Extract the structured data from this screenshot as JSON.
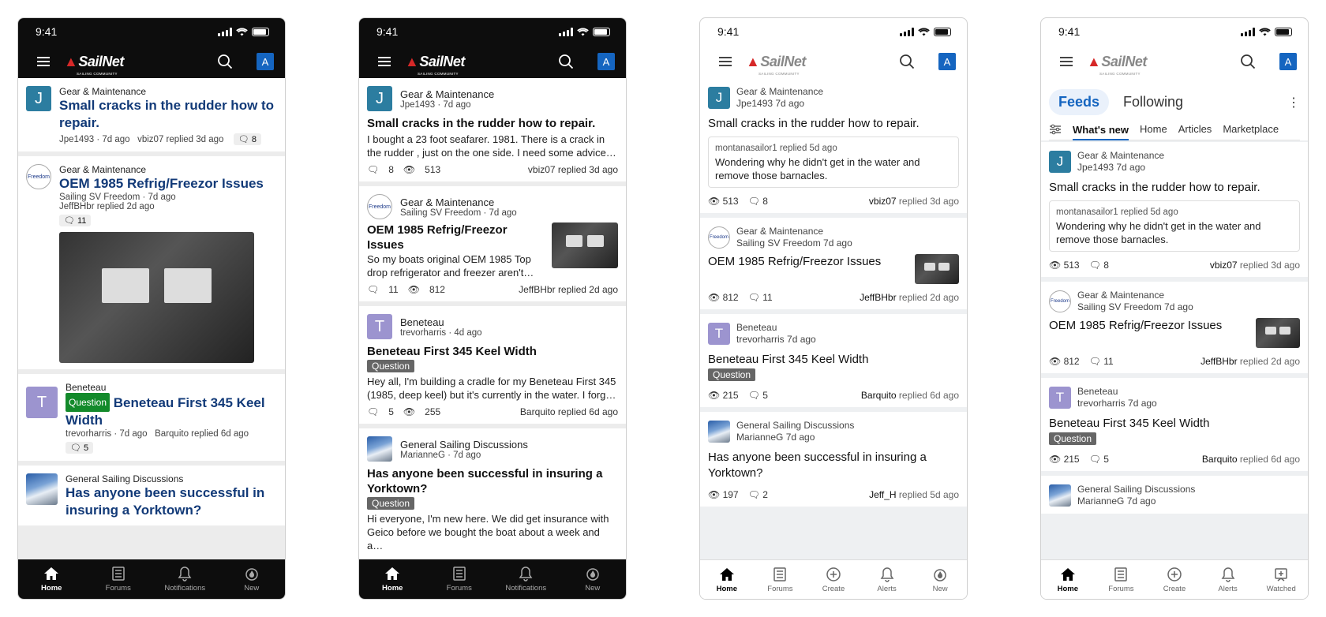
{
  "status_time": "9:41",
  "logo": {
    "brand": "SailNet",
    "sub": "SAILING COMMUNITY"
  },
  "avatar_letter": "A",
  "colors": {
    "accent": "#1565c0",
    "title_blue": "#123a78",
    "question_green": "#138a2b"
  },
  "tabs_v1": [
    {
      "label": "Home",
      "icon": "home-icon"
    },
    {
      "label": "Forums",
      "icon": "forums-icon"
    },
    {
      "label": "Notifications",
      "icon": "bell-icon"
    },
    {
      "label": "New",
      "icon": "flame-icon"
    }
  ],
  "tabs_v3": [
    {
      "label": "Home",
      "icon": "home-icon"
    },
    {
      "label": "Forums",
      "icon": "forums-icon"
    },
    {
      "label": "Create",
      "icon": "plus-icon"
    },
    {
      "label": "Alerts",
      "icon": "bell-icon"
    },
    {
      "label": "New",
      "icon": "flame-icon"
    }
  ],
  "tabs_v4": [
    {
      "label": "Home",
      "icon": "home-icon"
    },
    {
      "label": "Forums",
      "icon": "forums-icon"
    },
    {
      "label": "Create",
      "icon": "plus-icon"
    },
    {
      "label": "Alerts",
      "icon": "bell-icon"
    },
    {
      "label": "Watched",
      "icon": "watched-icon"
    }
  ],
  "p1": {
    "posts": [
      {
        "forum": "Gear & Maintenance",
        "title": "Small cracks in the rudder how to repair.",
        "meta": "Jpe1493 · 7d ago   vbiz07 replied 3d ago",
        "count": "8"
      },
      {
        "forum": "Gear & Maintenance",
        "title": "OEM 1985 Refrig/Freezor Issues",
        "meta": "Sailing SV Freedom · 7d ago",
        "meta2": "JeffBHbr replied 2d ago",
        "count": "11"
      },
      {
        "forum": "Beneteau",
        "badge": "Question",
        "title": "Beneteau First 345 Keel Width",
        "meta": "trevorharris · 7d ago   Barquito replied 6d ago",
        "count": "5"
      },
      {
        "forum": "General Sailing Discussions",
        "title": "Has anyone been successful in insuring a Yorktown?"
      }
    ]
  },
  "p2": {
    "posts": [
      {
        "forum": "Gear & Maintenance",
        "author": "Jpe1493",
        "age": "7d ago",
        "title": "Small cracks in the rudder how to repair.",
        "snippet": "I bought a 23 foot seafarer. 1981. There is a crack in the rudder , just on the one side. I need some advice…",
        "comments": "8",
        "views": "513",
        "reply": "vbiz07 replied 3d ago"
      },
      {
        "forum": "Gear & Maintenance",
        "author": "Sailing SV Freedom",
        "age": "7d ago",
        "title": "OEM 1985 Refrig/Freezor Issues",
        "snippet": "So my boats original OEM 1985 Top drop refrigerator and freezer aren't…",
        "comments": "11",
        "views": "812",
        "reply": "JeffBHbr replied 2d ago"
      },
      {
        "forum": "Beneteau",
        "author": "trevorharris",
        "age": "4d ago",
        "title": "Beneteau First 345 Keel Width",
        "badge": "Question",
        "snippet": "Hey all, I'm building a cradle for my Beneteau First 345 (1985, deep keel) but it's currently in the water. I forg…",
        "comments": "5",
        "views": "255",
        "reply": "Barquito replied 6d ago"
      },
      {
        "forum": "General Sailing Discussions",
        "author": "MarianneG",
        "age": "7d ago",
        "title": "Has anyone been successful in insuring a Yorktown?",
        "badge": "Question",
        "snippet": "Hi everyone, I'm new here. We did get insurance with Geico before we bought the boat about a week and a…"
      }
    ]
  },
  "p3": {
    "posts": [
      {
        "forum": "Gear & Maintenance",
        "authorline": "Jpe1493 7d ago",
        "title": "Small cracks in the rudder how to repair.",
        "quote_meta": "montanasailor1 replied 5d ago",
        "quote": "Wondering why he didn't get in the water and remove those barnacles.",
        "views": "513",
        "comments": "8",
        "reply_user": "vbiz07",
        "reply_rest": " replied 3d ago"
      },
      {
        "forum": "Gear & Maintenance",
        "authorline": "Sailing SV Freedom 7d ago",
        "title": "OEM 1985 Refrig/Freezor Issues",
        "views": "812",
        "comments": "11",
        "reply_user": "JeffBHbr",
        "reply_rest": " replied 2d ago"
      },
      {
        "forum": "Beneteau",
        "authorline": "trevorharris 7d ago",
        "title": "Beneteau First 345 Keel Width",
        "badge": "Question",
        "views": "215",
        "comments": "5",
        "reply_user": "Barquito",
        "reply_rest": " replied 6d ago"
      },
      {
        "forum": "General Sailing Discussions",
        "authorline": "MarianneG 7d ago",
        "title": "Has anyone been successful in insuring a Yorktown?",
        "views": "197",
        "comments": "2",
        "reply_user": "Jeff_H",
        "reply_rest": " replied 5d ago"
      }
    ]
  },
  "p4": {
    "feeds_label": "Feeds",
    "following_label": "Following",
    "subtabs": [
      "What's new",
      "Home",
      "Articles",
      "Marketplace"
    ],
    "posts": [
      {
        "forum": "Gear & Maintenance",
        "authorline": "Jpe1493 7d ago",
        "title": "Small cracks in the rudder how to repair.",
        "quote_meta": "montanasailor1 replied 5d ago",
        "quote": "Wondering why he didn't get in the water and remove those barnacles.",
        "views": "513",
        "comments": "8",
        "reply_user": "vbiz07",
        "reply_rest": " replied 3d ago"
      },
      {
        "forum": "Gear & Maintenance",
        "authorline": "Sailing SV Freedom 7d ago",
        "title": "OEM 1985 Refrig/Freezor Issues",
        "views": "812",
        "comments": "11",
        "reply_user": "JeffBHbr",
        "reply_rest": " replied 2d ago"
      },
      {
        "forum": "Beneteau",
        "authorline": "trevorharris 7d ago",
        "title": "Beneteau First 345 Keel Width",
        "badge": "Question",
        "views": "215",
        "comments": "5",
        "reply_user": "Barquito",
        "reply_rest": " replied 6d ago"
      },
      {
        "forum": "General Sailing Discussions",
        "authorline": "MarianneG 7d ago"
      }
    ]
  }
}
